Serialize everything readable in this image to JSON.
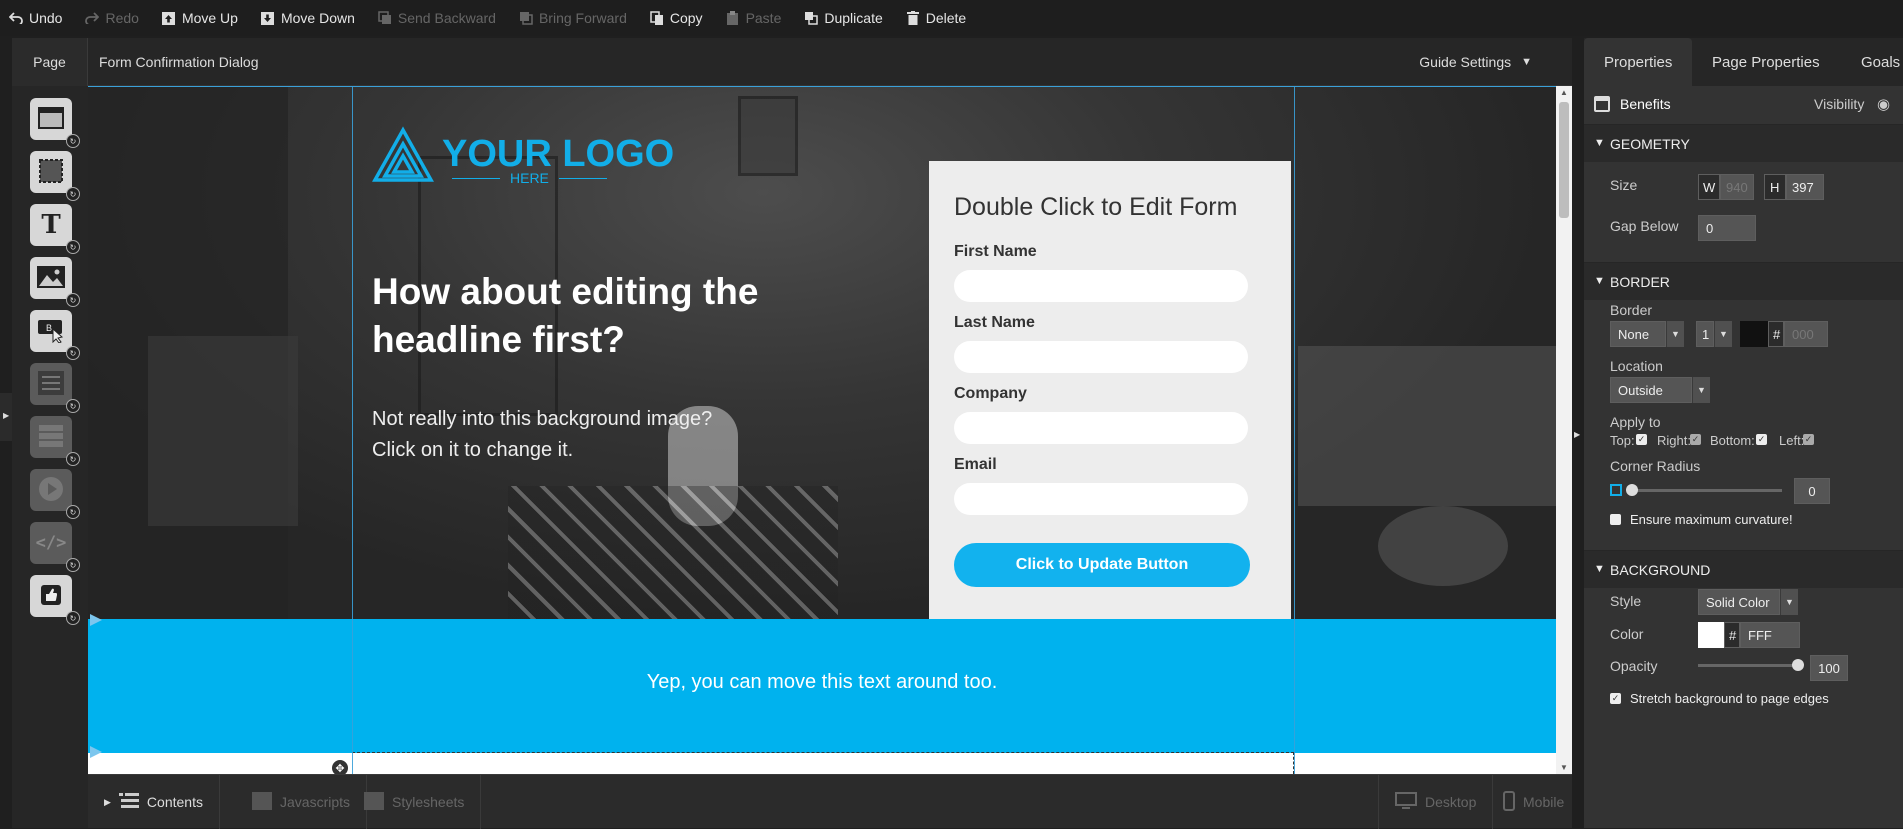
{
  "toolbar": {
    "undo": "Undo",
    "redo": "Redo",
    "move_up": "Move Up",
    "move_down": "Move Down",
    "send_backward": "Send Backward",
    "bring_forward": "Bring Forward",
    "copy": "Copy",
    "paste": "Paste",
    "duplicate": "Duplicate",
    "delete": "Delete"
  },
  "tabbar": {
    "page_tab": "Page",
    "page_name": "Form Confirmation Dialog",
    "guide_settings": "Guide Settings"
  },
  "canvas": {
    "logo_main": "YOUR LOGO",
    "logo_sub": "HERE",
    "headline": "How about editing the headline first?",
    "body": "Not really into this background image? Click on it to change it.",
    "form_title": "Double Click to Edit Form",
    "fields": [
      "First Name",
      "Last Name",
      "Company",
      "Email"
    ],
    "button": "Click to Update Button",
    "band_text": "Yep, you can move this text around too."
  },
  "bottombar": {
    "contents": "Contents",
    "javascripts": "Javascripts",
    "stylesheets": "Stylesheets",
    "desktop": "Desktop",
    "mobile": "Mobile"
  },
  "properties": {
    "tabs": [
      "Properties",
      "Page Properties",
      "Goals"
    ],
    "element_name": "Benefits",
    "visibility": "Visibility",
    "geometry": {
      "title": "GEOMETRY",
      "size_label": "Size",
      "w_label": "W",
      "w_value": "940",
      "h_label": "H",
      "h_value": "397",
      "gap_label": "Gap Below",
      "gap_value": "0"
    },
    "border": {
      "title": "BORDER",
      "border_label": "Border",
      "style_value": "None",
      "width_value": "1",
      "hash": "#",
      "color_placeholder": "000",
      "location_label": "Location",
      "location_value": "Outside",
      "apply_label": "Apply to",
      "top": "Top:",
      "right": "Right:",
      "bottom": "Bottom:",
      "left": "Left:",
      "corner_label": "Corner Radius",
      "corner_value": "0",
      "curvature": "Ensure maximum curvature!"
    },
    "background": {
      "title": "BACKGROUND",
      "style_label": "Style",
      "style_value": "Solid Color",
      "color_label": "Color",
      "hash": "#",
      "color_value": "FFF",
      "opacity_label": "Opacity",
      "opacity_value": "100",
      "stretch": "Stretch background to page edges"
    }
  },
  "colors": {
    "accent": "#00b2ee",
    "toolbar_bg": "#1e1e1e",
    "panel_bg": "#333333"
  }
}
